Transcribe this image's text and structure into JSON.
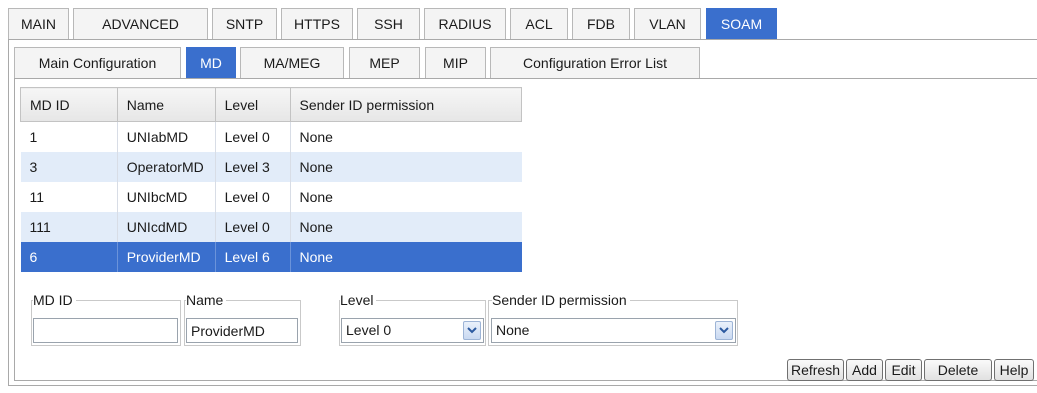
{
  "tabs": [
    "MAIN",
    "ADVANCED",
    "SNTP",
    "HTTPS",
    "SSH",
    "RADIUS",
    "ACL",
    "FDB",
    "VLAN",
    "SOAM"
  ],
  "active_tab": "SOAM",
  "subtabs": [
    "Main Configuration",
    "MD",
    "MA/MEG",
    "MEP",
    "MIP",
    "Configuration Error List"
  ],
  "active_subtab": "MD",
  "table": {
    "headers": [
      "MD ID",
      "Name",
      "Level",
      "Sender ID permission"
    ],
    "rows": [
      [
        "1",
        "UNIabMD",
        "Level 0",
        "None"
      ],
      [
        "3",
        "OperatorMD",
        "Level 3",
        "None"
      ],
      [
        "11",
        "UNIbcMD",
        "Level 0",
        "None"
      ],
      [
        "111",
        "UNIcdMD",
        "Level 0",
        "None"
      ],
      [
        "6",
        "ProviderMD",
        "Level 6",
        "None"
      ]
    ],
    "selected_row": 4
  },
  "form": {
    "md_id_label": "MD ID",
    "md_id_value": "",
    "name_label": "Name",
    "name_value": "ProviderMD",
    "level_label": "Level",
    "level_value": "Level 0",
    "sender_label": "Sender ID permission",
    "sender_value": "None"
  },
  "buttons": {
    "refresh": "Refresh",
    "add": "Add",
    "edit": "Edit",
    "delete": "Delete",
    "help": "Help"
  },
  "colors": {
    "accent": "#3a6fcd",
    "row_alt": "#e2ecf9"
  },
  "icons": {
    "dropdown": "chevron-down-icon"
  }
}
